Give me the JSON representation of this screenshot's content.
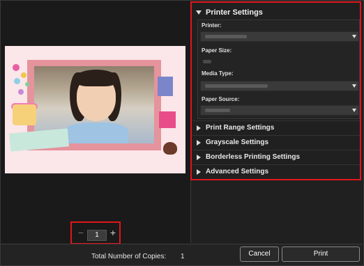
{
  "printer_settings": {
    "title": "Printer Settings",
    "printer_label": "Printer:",
    "paper_size_label": "Paper Size:",
    "media_type_label": "Media Type:",
    "paper_source_label": "Paper Source:"
  },
  "sections": [
    {
      "label": "Print Range Settings"
    },
    {
      "label": "Grayscale Settings"
    },
    {
      "label": "Borderless Printing Settings"
    },
    {
      "label": "Advanced Settings"
    }
  ],
  "copies": {
    "value": "1",
    "minus_symbol": "−",
    "plus_symbol": "+",
    "total_label": "Total Number of Copies:",
    "total_value": "1"
  },
  "buttons": {
    "cancel": "Cancel",
    "print": "Print"
  },
  "icons": {
    "expanded": "triangle-down-icon",
    "collapsed": "triangle-right-icon",
    "dropdown": "chevron-down-icon"
  },
  "colors": {
    "highlight": "#e0161b",
    "background": "#1e1e1e"
  }
}
